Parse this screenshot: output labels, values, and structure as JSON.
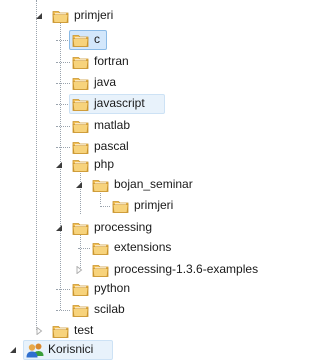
{
  "colors": {
    "folder_body": "#f2c057",
    "folder_front": "#f7d37c",
    "folder_edge": "#c9932b",
    "selection": "#d3e7fb",
    "hover": "#e8f2fb",
    "expander_open": "#3c3c3c",
    "expander_closed": "#b0b0b0",
    "guide_line": "#9aa3ad"
  },
  "tree": {
    "nodes": [
      {
        "label": "primjeri",
        "icon": "folder-icon",
        "expander": "expanded",
        "state": "normal"
      },
      {
        "label": "c",
        "icon": "folder-icon",
        "expander": "none",
        "state": "selected"
      },
      {
        "label": "fortran",
        "icon": "folder-icon",
        "expander": "none",
        "state": "normal"
      },
      {
        "label": "java",
        "icon": "folder-icon",
        "expander": "none",
        "state": "normal"
      },
      {
        "label": "javascript",
        "icon": "folder-icon",
        "expander": "none",
        "state": "hover"
      },
      {
        "label": "matlab",
        "icon": "folder-icon",
        "expander": "none",
        "state": "normal"
      },
      {
        "label": "pascal",
        "icon": "folder-icon",
        "expander": "none",
        "state": "normal"
      },
      {
        "label": "php",
        "icon": "folder-icon",
        "expander": "expanded",
        "state": "normal"
      },
      {
        "label": "bojan_seminar",
        "icon": "folder-icon",
        "expander": "expanded",
        "state": "normal"
      },
      {
        "label": "primjeri",
        "icon": "folder-icon",
        "expander": "none",
        "state": "normal"
      },
      {
        "label": "processing",
        "icon": "folder-icon",
        "expander": "expanded",
        "state": "normal"
      },
      {
        "label": "extensions",
        "icon": "folder-icon",
        "expander": "none",
        "state": "normal"
      },
      {
        "label": "processing-1.3.6-examples",
        "icon": "folder-icon",
        "expander": "collapsed",
        "state": "normal"
      },
      {
        "label": "python",
        "icon": "folder-icon",
        "expander": "none",
        "state": "normal"
      },
      {
        "label": "scilab",
        "icon": "folder-icon",
        "expander": "none",
        "state": "normal"
      },
      {
        "label": "test",
        "icon": "folder-icon",
        "expander": "collapsed",
        "state": "normal"
      },
      {
        "label": "Korisnici",
        "icon": "users-icon",
        "expander": "expanded",
        "state": "hover"
      }
    ]
  }
}
